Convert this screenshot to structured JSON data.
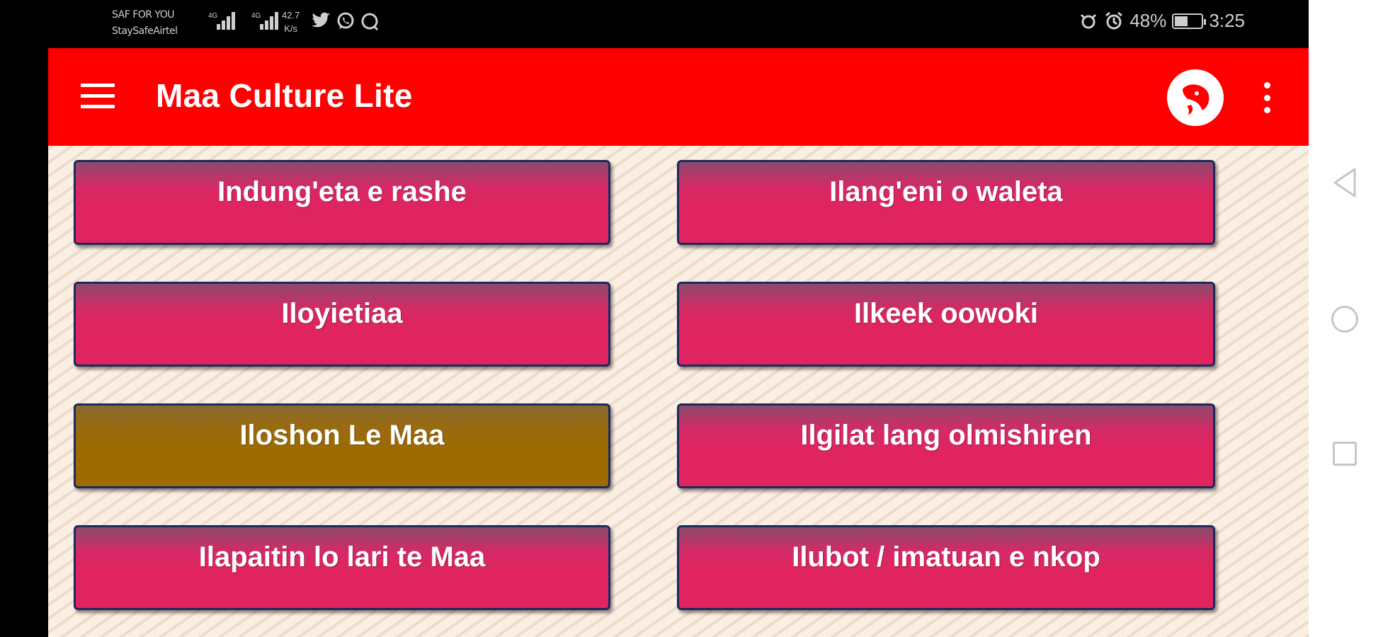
{
  "status_bar": {
    "carrier_line1": "SAF FOR YOU",
    "carrier_line2": "StaySafeAirtel",
    "network_1": "4G",
    "network_2": "4G",
    "speed_value": "42.7",
    "speed_unit": "K/s",
    "battery_percent": "48%",
    "battery_level": 0.48,
    "time": "3:25"
  },
  "app_bar": {
    "title": "Maa Culture Lite"
  },
  "menu": {
    "buttons": [
      {
        "label": "Indung'eta e rashe"
      },
      {
        "label": "Ilang'eni o waleta"
      },
      {
        "label": "Iloyietiaa"
      },
      {
        "label": "Ilkeek oowoki"
      },
      {
        "label": "Iloshon Le Maa"
      },
      {
        "label": "Ilgilat lang olmishiren"
      },
      {
        "label": "Ilapaitin lo lari te Maa"
      },
      {
        "label": "Ilubot / imatuan e nkop"
      }
    ]
  },
  "colors": {
    "app_bar": "#ff0000",
    "button_pink": "#e0245f",
    "button_selected": "#9e6b02",
    "button_border": "#1a2a5c",
    "background": "#fbeee2"
  }
}
